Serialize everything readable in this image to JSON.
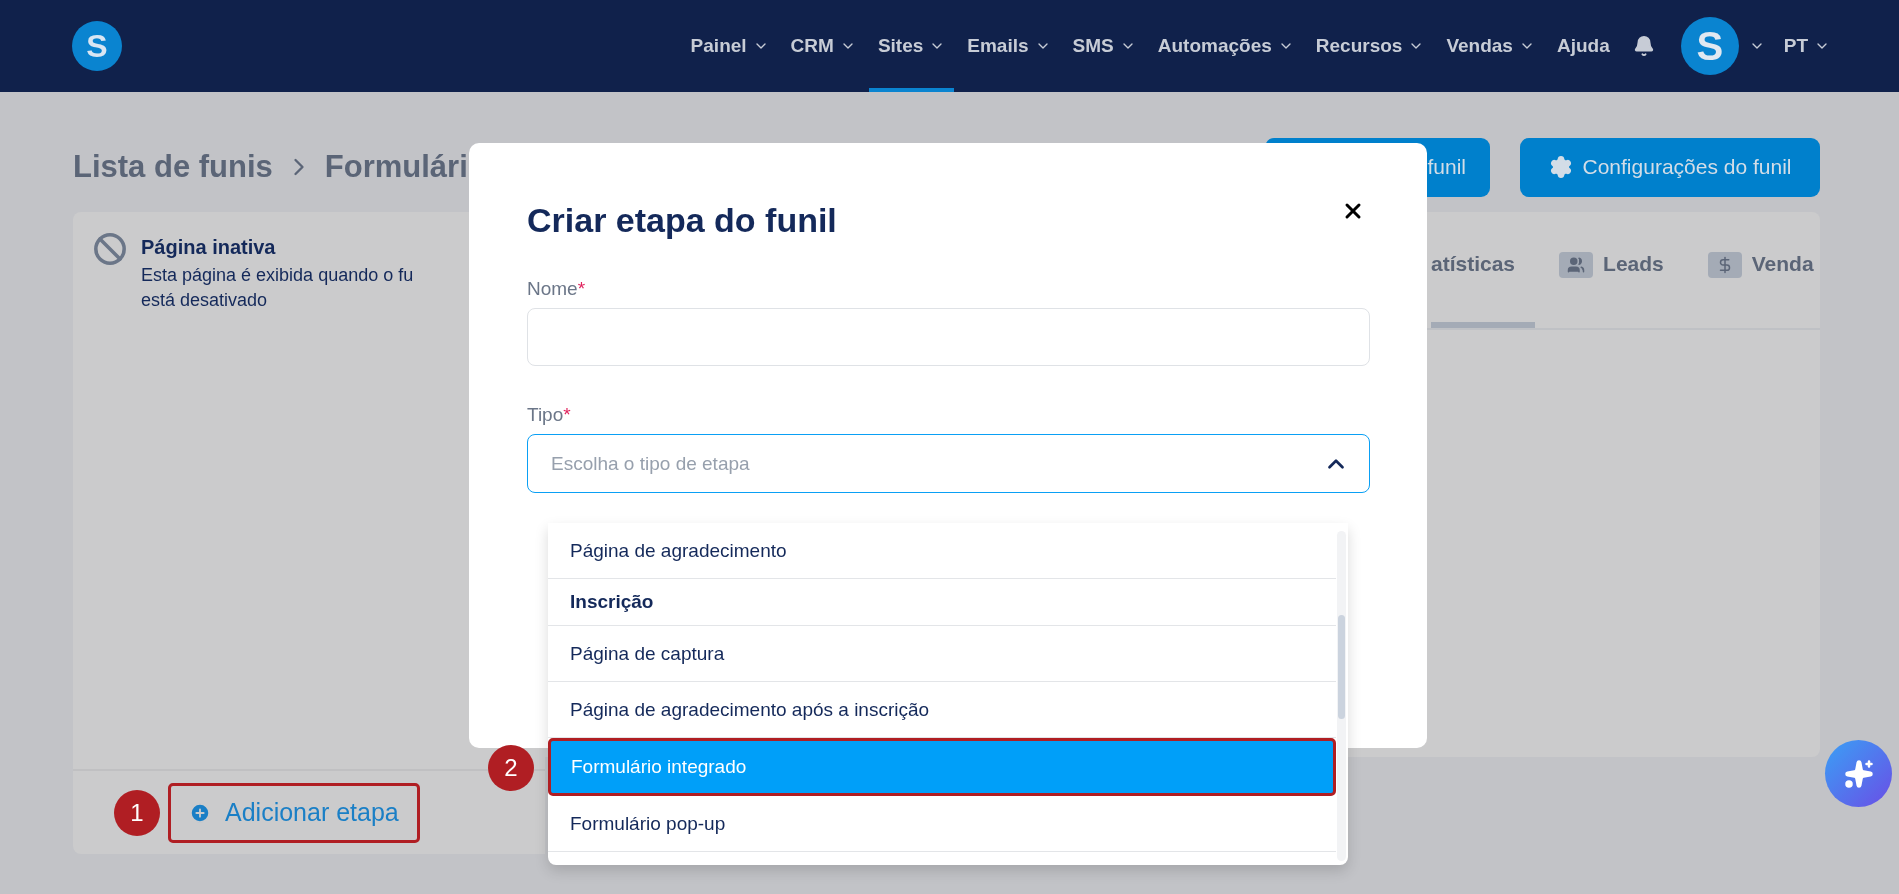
{
  "nav": {
    "logo": "S",
    "items": [
      {
        "label": "Painel",
        "selected": false,
        "has_caret": true
      },
      {
        "label": "CRM",
        "selected": false,
        "has_caret": true
      },
      {
        "label": "Sites",
        "selected": true,
        "has_caret": true
      },
      {
        "label": "Emails",
        "selected": false,
        "has_caret": true
      },
      {
        "label": "SMS",
        "selected": false,
        "has_caret": true
      },
      {
        "label": "Automações",
        "selected": false,
        "has_caret": true
      },
      {
        "label": "Recursos",
        "selected": false,
        "has_caret": true
      },
      {
        "label": "Vendas",
        "selected": false,
        "has_caret": true
      },
      {
        "label": "Ajuda",
        "selected": false,
        "has_caret": false
      }
    ],
    "avatar": "S",
    "language": "PT"
  },
  "breadcrumb": [
    "Lista de funis",
    "Formulári"
  ],
  "header_buttons": [
    {
      "label": "funil"
    },
    {
      "label": "Configurações do funil"
    }
  ],
  "inactive_page": {
    "title": "Página inativa",
    "description": [
      "Esta página é exibida quando o fu",
      "está desativado"
    ]
  },
  "add_step": {
    "label": "Adicionar etapa",
    "highlighted": true,
    "badge": "1"
  },
  "tabs": [
    {
      "label": "atísticas",
      "selected": true
    },
    {
      "label": "Leads",
      "selected": false
    },
    {
      "label": "Venda",
      "selected": false
    }
  ],
  "modal": {
    "title": "Criar etapa do funil",
    "fields": [
      {
        "kind": "text",
        "label": "Nome",
        "required_mark": "*"
      },
      {
        "kind": "select",
        "label": "Tipo",
        "required_mark": "*",
        "placeholder": "Escolha o tipo de etapa",
        "expanded": true
      }
    ],
    "options": [
      {
        "kind": "option",
        "label": "Página de agradecimento",
        "selected": false,
        "highlighted": false
      },
      {
        "kind": "group",
        "label": "Inscrição"
      },
      {
        "kind": "option",
        "label": "Página de captura",
        "selected": false,
        "highlighted": false
      },
      {
        "kind": "option",
        "label": "Página de agradecimento após a inscrição",
        "selected": false,
        "highlighted": false
      },
      {
        "kind": "option",
        "label": "Formulário integrado",
        "selected": true,
        "highlighted": true,
        "badge": "2"
      },
      {
        "kind": "option",
        "label": "Formulário pop-up",
        "selected": false,
        "highlighted": false
      }
    ]
  }
}
